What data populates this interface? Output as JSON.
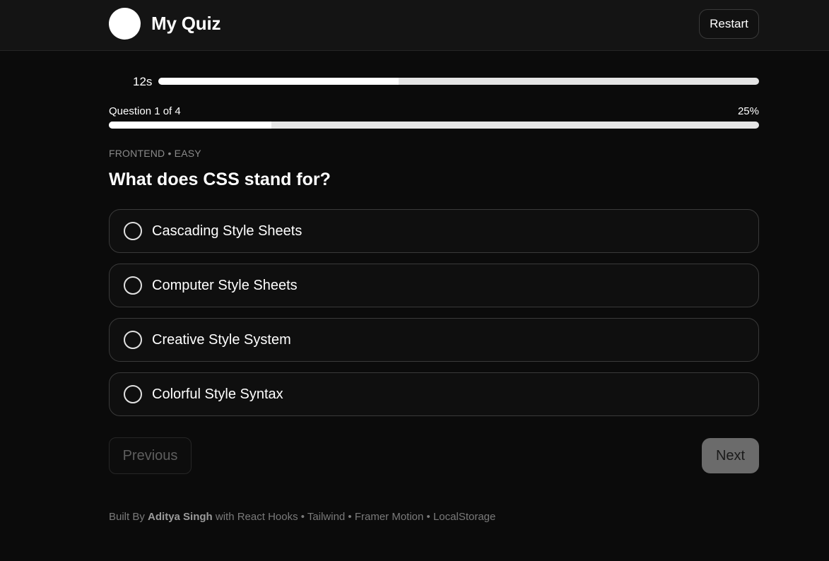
{
  "header": {
    "title": "My Quiz",
    "restart_label": "Restart"
  },
  "timer": {
    "label": "12s",
    "remaining_fraction": 0.4
  },
  "progress": {
    "label": "Question 1 of 4",
    "percent_label": "25%",
    "fraction": 0.25
  },
  "question": {
    "meta": "FRONTEND • EASY",
    "text": "What does CSS stand for?",
    "options": [
      {
        "label": "Cascading Style Sheets"
      },
      {
        "label": "Computer Style Sheets"
      },
      {
        "label": "Creative Style System"
      },
      {
        "label": "Colorful Style Syntax"
      }
    ]
  },
  "nav": {
    "previous_label": "Previous",
    "next_label": "Next"
  },
  "footer": {
    "prefix": "Built By",
    "author": "Aditya Singh",
    "suffix": "with React Hooks • Tailwind • Framer Motion • LocalStorage"
  },
  "colors": {
    "background": "#0b0b0b",
    "header": "#141414",
    "accent": "#ffffff",
    "track": "#e5e5e5",
    "muted": "#8a8a8a"
  }
}
